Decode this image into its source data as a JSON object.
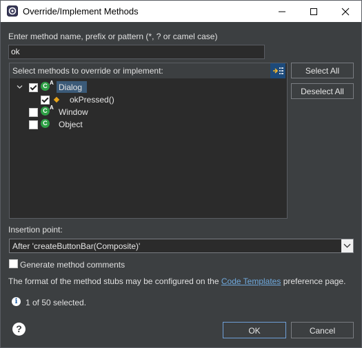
{
  "window": {
    "title": "Override/Implement Methods"
  },
  "filter": {
    "label": "Enter method name, prefix or pattern (*, ? or camel case)",
    "value": "ok"
  },
  "tree": {
    "header": "Select methods to override or implement:",
    "rows": [
      {
        "label": "Dialog",
        "checked": true,
        "expanded": true,
        "selected": true,
        "icon": "class-icon"
      },
      {
        "label": "okPressed()",
        "checked": true,
        "icon": "method-icon"
      },
      {
        "label": "Window",
        "checked": false,
        "icon": "class-icon"
      },
      {
        "label": "Object",
        "checked": false,
        "icon": "class-icon"
      }
    ]
  },
  "buttons": {
    "select_all": "Select All",
    "deselect_all": "Deselect All",
    "ok": "OK",
    "cancel": "Cancel"
  },
  "insertion": {
    "label": "Insertion point:",
    "value": "After 'createButtonBar(Composite)'"
  },
  "generate_comments": {
    "label": "Generate method comments",
    "checked": false
  },
  "format_note": {
    "before": "The format of the method stubs may be configured on the",
    "link": "Code Templates",
    "after": "preference page."
  },
  "status": {
    "text": "1 of 50 selected."
  },
  "colors": {
    "accent": "#6f9fd8",
    "class_icon": "#2e9f45",
    "method_icon": "#e6a31a",
    "link": "#6fa8dc"
  }
}
